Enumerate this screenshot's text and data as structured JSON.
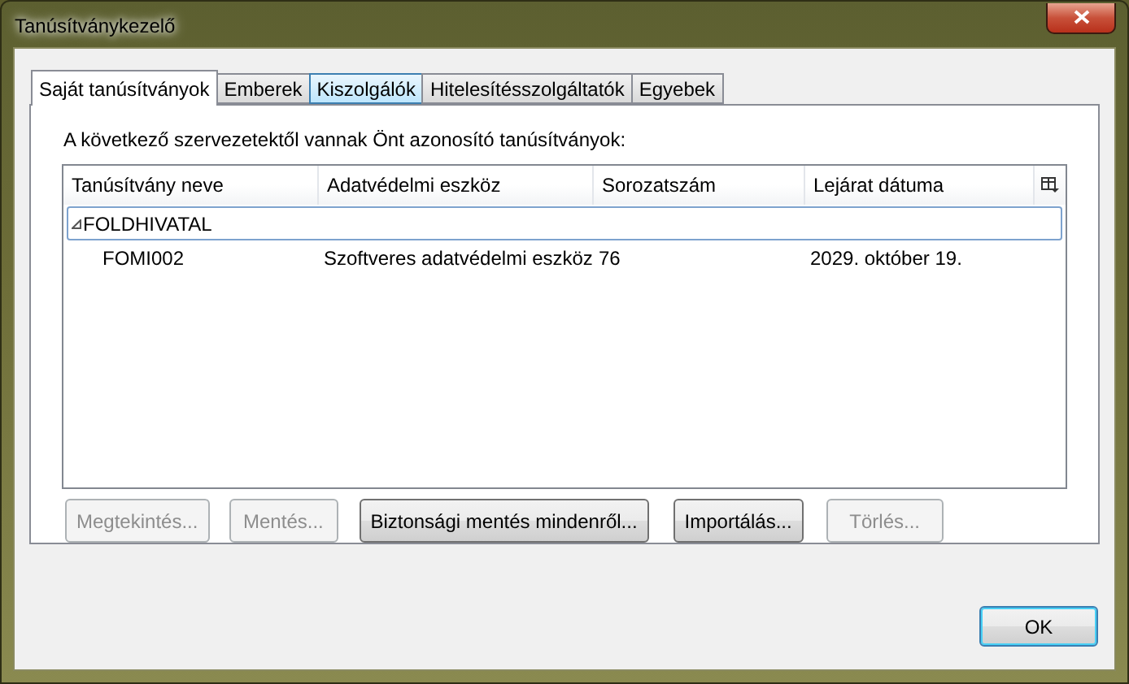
{
  "window": {
    "title": "Tanúsítványkezelő"
  },
  "tabs": [
    {
      "label": "Saját tanúsítványok",
      "selected": true,
      "hovered": false
    },
    {
      "label": "Emberek",
      "selected": false,
      "hovered": false
    },
    {
      "label": "Kiszolgálók",
      "selected": false,
      "hovered": true
    },
    {
      "label": "Hitelesítésszolgáltatók",
      "selected": false,
      "hovered": false
    },
    {
      "label": "Egyebek",
      "selected": false,
      "hovered": false
    }
  ],
  "intro": "A következő szervezetektől vannak Önt azonosító tanúsítványok:",
  "table": {
    "columns": [
      "Tanúsítvány neve",
      "Adatvédelmi eszköz",
      "Sorozatszám",
      "Lejárat dátuma"
    ],
    "groups": [
      {
        "name": "FOLDHIVATAL",
        "expanded": true,
        "selected": true,
        "children": [
          {
            "cells": [
              "FOMI002",
              "Szoftveres adatvédelmi eszköz",
              "76",
              "2029. október 19."
            ]
          }
        ]
      }
    ]
  },
  "buttons": [
    {
      "label": "Megtekintés...",
      "disabled": true
    },
    {
      "label": "Mentés...",
      "disabled": true
    },
    {
      "label": "Biztonsági mentés mindenről...",
      "disabled": false
    },
    {
      "label": "Importálás...",
      "disabled": false
    },
    {
      "label": "Törlés...",
      "disabled": true
    }
  ],
  "ok_button": {
    "label": "OK"
  }
}
